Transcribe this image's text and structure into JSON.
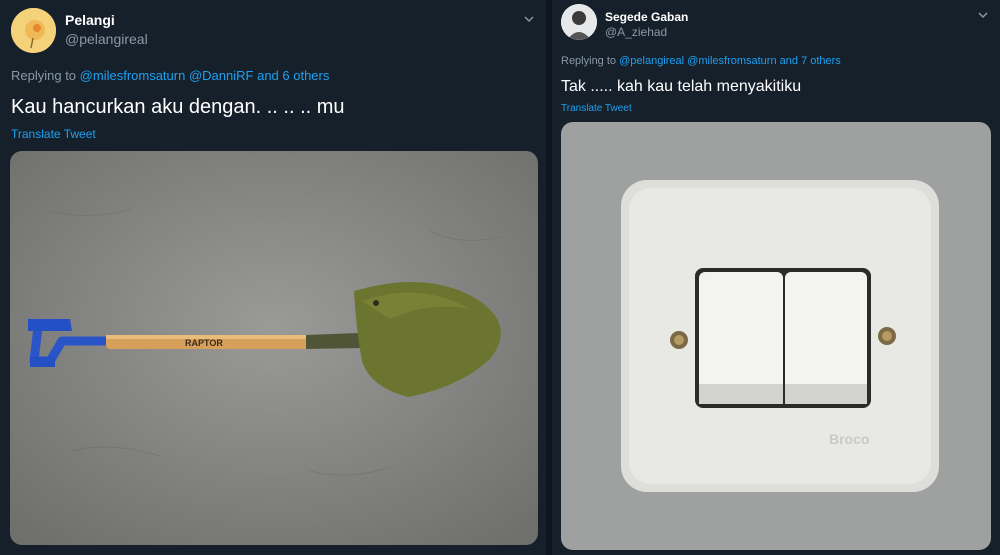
{
  "tweets": [
    {
      "name": "Pelangi",
      "handle": "@pelangireal",
      "replying_prefix": "Replying to",
      "mentions": [
        "@milesfromsaturn",
        "@DanniRF"
      ],
      "others": "and 6 others",
      "text": "Kau hancurkan aku dengan. .. .. ..  mu",
      "translate": "Translate Tweet",
      "media_brand_text": "RAPTOR",
      "icon": "chevron-down-icon"
    },
    {
      "name": "Segede Gaban",
      "handle": "@A_ziehad",
      "replying_prefix": "Replying to",
      "mentions": [
        "@pelangireal",
        "@milesfromsaturn"
      ],
      "others": "and 7 others",
      "text": "Tak ..... kah kau telah menyakitiku",
      "translate": "Translate Tweet",
      "media_brand_text": "Broco",
      "icon": "chevron-down-icon"
    }
  ],
  "colors": {
    "background": "#15202b",
    "link": "#1da1f2",
    "secondary_text": "#8899a6"
  }
}
